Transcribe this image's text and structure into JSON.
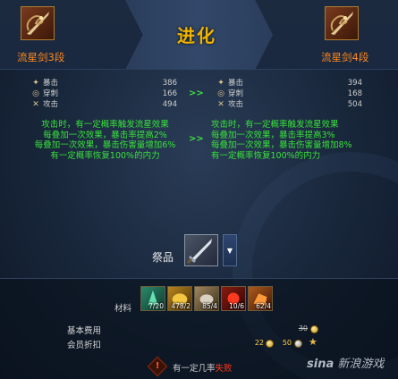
{
  "header": {
    "title": "进化"
  },
  "left_item": {
    "name": "流星剑3段",
    "icon": "dragon-sword-icon",
    "stats": [
      {
        "icon": "crit-icon",
        "label": "暴击",
        "value": "386"
      },
      {
        "icon": "pierce-icon",
        "label": "穿刺",
        "value": "166"
      },
      {
        "icon": "attack-icon",
        "label": "攻击",
        "value": "494"
      }
    ],
    "effect": [
      "攻击时，有一定概率触发流星效果",
      "每叠加一次效果，暴击率提高2%",
      "每叠加一次效果，暴击伤害量增加6%",
      "有一定概率恢复100%的内力"
    ]
  },
  "right_item": {
    "name": "流星剑4段",
    "icon": "dragon-sword-icon",
    "stats": [
      {
        "icon": "crit-icon",
        "label": "暴击",
        "value": "394"
      },
      {
        "icon": "pierce-icon",
        "label": "穿刺",
        "value": "168"
      },
      {
        "icon": "attack-icon",
        "label": "攻击",
        "value": "504"
      }
    ],
    "effect": [
      "攻击时，有一定概率触发流星效果",
      "每叠加一次效果，暴击率提高3%",
      "每叠加一次效果，暴击伤害量增加8%",
      "有一定概率恢复100%的内力"
    ]
  },
  "arrows": {
    "stats": ">>",
    "effect": ">>"
  },
  "catalyst": {
    "label": "祭品",
    "slot_icon": "sword-icon",
    "dropdown_icon": "triangle-down-icon"
  },
  "materials": {
    "label": "材料",
    "items": [
      {
        "icon": "green-crystal-icon",
        "qty": "7/20",
        "color": "#1a5a4a"
      },
      {
        "icon": "gold-ore-icon",
        "qty": "478/2",
        "color": "#6a4a10"
      },
      {
        "icon": "metal-lump-icon",
        "qty": "85/4",
        "color": "#5a4a2a"
      },
      {
        "icon": "red-gem-icon",
        "qty": "10/6",
        "color": "#5a1510"
      },
      {
        "icon": "orange-ore-icon",
        "qty": "62/4",
        "color": "#6a3510"
      }
    ]
  },
  "fees": {
    "base_label": "基本费用",
    "base_value": "30",
    "member_label": "会员折扣",
    "member_value_a": "22",
    "member_value_b": "50"
  },
  "warning": {
    "icon": "warning-icon",
    "text_prefix": "有一定几率",
    "text_fail": "失败"
  },
  "watermark": {
    "logo": "sina",
    "text": "新浪游戏"
  }
}
